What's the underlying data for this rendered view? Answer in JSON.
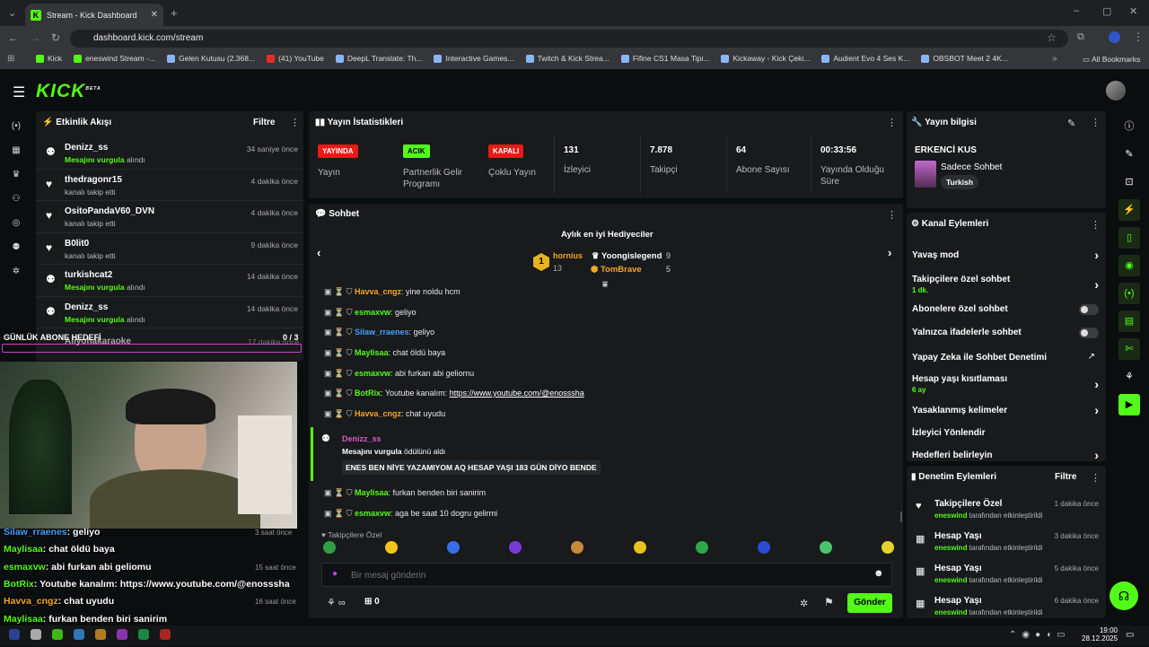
{
  "browser": {
    "tab_title": "Stream - Kick Dashboard",
    "url": "dashboard.kick.com/stream",
    "bookmarks": [
      "Kick",
      "eneswind Stream -...",
      "Gelen Kutusu (2.368...",
      "(41) YouTube",
      "DeepL Translate: Th...",
      "Interactive Games...",
      "Twitch & Kick Strea...",
      "Fifine CS1 Masa Tipi...",
      "Kickaway - Kick Çeki...",
      "Audient Evo 4 Ses K...",
      "OBSBOT Meet 2 4K..."
    ],
    "all_bookmarks": "All Bookmarks"
  },
  "brand": "KICK",
  "brand_beta": "BETA",
  "activity": {
    "title": "Etkinlik Akışı",
    "filter": "Filtre",
    "items": [
      {
        "name": "Denizz_ss",
        "green": "Mesajını vurgula",
        "rest": " alındı",
        "time": "34 saniye önce"
      },
      {
        "name": "thedragonr15",
        "green": "",
        "rest": "kanalı takip etti",
        "time": "4 dakika önce"
      },
      {
        "name": "OsitoPandaV60_DVN",
        "green": "",
        "rest": "kanalı takip etti",
        "time": "4 dakika önce"
      },
      {
        "name": "B0lit0",
        "green": "",
        "rest": "kanalı takip etti",
        "time": "9 dakika önce"
      },
      {
        "name": "turkishcat2",
        "green": "Mesajını vurgula",
        "rest": " alındı",
        "time": "14 dakika önce"
      },
      {
        "name": "Denizz_ss",
        "green": "Mesajını vurgula",
        "rest": " alındı",
        "time": "14 dakika önce"
      }
    ]
  },
  "goal": {
    "label": "GÜNLÜK ABONE HEDEFİ",
    "count": "0 / 3",
    "under_name": "Aliyohakaraoke",
    "under_time": "17 dakika önce"
  },
  "stats": {
    "title": "Yayın İstatistikleri",
    "badges": [
      {
        "badge": "YAYINDA",
        "label": "Yayın"
      },
      {
        "badge": "ACIK",
        "label": "Partnerlik Gelir Programı"
      },
      {
        "badge": "KAPALI",
        "label": "Çoklu Yayın"
      }
    ],
    "numbers": [
      {
        "value": "131",
        "label": "İzleyici"
      },
      {
        "value": "7.878",
        "label": "Takipçi"
      },
      {
        "value": "64",
        "label": "Abone Sayısı"
      },
      {
        "value": "00:33:56",
        "label": "Yayında Olduğu Süre"
      }
    ]
  },
  "chat": {
    "title": "Sohbet",
    "gifters_title": "Aylık en iyi Hediyeciler",
    "gifters": [
      {
        "rank": "1",
        "name": "hornius",
        "count": "13"
      },
      {
        "name": "Yoongislegend",
        "count": "9"
      },
      {
        "name": "TomBrave",
        "count": "5"
      }
    ],
    "messages": [
      {
        "user": "Havva_cngz",
        "text": "yine noldu hcm",
        "color": "#f5a623"
      },
      {
        "user": "esmaxvw",
        "text": "geliyo",
        "color": "#53fc18"
      },
      {
        "user": "Silaw_rraenes",
        "text": "geliyo",
        "color": "#4a9eff"
      },
      {
        "user": "Maylisaa",
        "text": "chat öldü baya",
        "color": "#53fc18"
      },
      {
        "user": "esmaxvw",
        "text": "abi furkan abi geliomu",
        "color": "#53fc18"
      },
      {
        "user": "BotRix",
        "text": "Youtube kanalım: ",
        "link": "https://www.youtube.com/@enosssha",
        "color": "#53fc18"
      },
      {
        "user": "Havva_cngz",
        "text": "chat uyudu",
        "color": "#f5a623"
      }
    ],
    "highlight": {
      "user": "Denizz_ss",
      "line1": "Mesajını vurgula",
      "line1b": " ödülünü aldı",
      "message": "ENES BEN NİYE YAZAMIYOM AQ HESAP YAŞI 183 GÜN DİYO BENDE"
    },
    "messages2": [
      {
        "user": "Maylisaa",
        "text": "furkan benden biri sanirim",
        "color": "#53fc18"
      },
      {
        "user": "esmaxvw",
        "text": "aga be saat 10 dogru gelirmi",
        "color": "#53fc18"
      }
    ],
    "followers_only": "Takipçilere Özel",
    "placeholder": "Bir mesaj gönderin",
    "send": "Gönder",
    "points": "0"
  },
  "info": {
    "title": "Yayın bilgisi",
    "stream_title": "ERKENCİ KUS",
    "category": "Sadece Sohbet",
    "tag": "Turkish"
  },
  "channel": {
    "title": "Kanal Eylemleri",
    "items": [
      {
        "label": "Yavaş mod",
        "sub": "",
        "type": "arrow"
      },
      {
        "label": "Takipçilere özel sohbet",
        "sub": "1 dk.",
        "type": "arrow"
      },
      {
        "label": "Abonelere özel sohbet",
        "sub": "",
        "type": "toggle"
      },
      {
        "label": "Yalnızca ifadelerle sohbet",
        "sub": "",
        "type": "toggle"
      },
      {
        "label": "Yapay Zeka ile Sohbet Denetimi",
        "sub": "",
        "type": "ext"
      },
      {
        "label": "Hesap yaşı kısıtlaması",
        "sub": "6 ay",
        "type": "arrow"
      },
      {
        "label": "Yasaklanmış kelimeler",
        "sub": "",
        "type": "arrow"
      },
      {
        "label": "İzleyici Yönlendir",
        "sub": "",
        "type": "none"
      },
      {
        "label": "Hedefleri belirleyin",
        "sub": "",
        "type": "arrow"
      }
    ]
  },
  "mod": {
    "title": "Denetim Eylemleri",
    "filter": "Filtre",
    "items": [
      {
        "action": "Takipçilere Özel",
        "by": "eneswind",
        "rest": " tarafından etkinleştirildi",
        "time": "1 dakika önce"
      },
      {
        "action": "Hesap Yaşı",
        "by": "eneswind",
        "rest": " tarafından etkinleştirildi",
        "time": "3 dakika önce"
      },
      {
        "action": "Hesap Yaşı",
        "by": "eneswind",
        "rest": " tarafından etkinleştirildi",
        "time": "5 dakika önce"
      },
      {
        "action": "Hesap Yaşı",
        "by": "eneswind",
        "rest": " tarafından etkinleştirildi",
        "time": "6 dakika önce"
      }
    ]
  },
  "overlay": {
    "lines": [
      {
        "user": "Silaw_rraenes",
        "text": ": geliyo",
        "color": "#4a9eff",
        "time": "3 saat önce"
      },
      {
        "user": "Maylisaa",
        "text": ": chat öldü baya",
        "color": "#53fc18",
        "time": ""
      },
      {
        "user": "esmaxvw",
        "text": ": abi furkan abi geliomu",
        "color": "#53fc18",
        "time": "15 saat önce"
      },
      {
        "user": "BotRix",
        "text": ": Youtube kanalım: https://www.youtube.com/@enosssha",
        "color": "#53fc18",
        "time": ""
      },
      {
        "user": "Havva_cngz",
        "text": ": chat uyudu",
        "color": "#f5a623",
        "time": "16 saat önce"
      },
      {
        "user": "Maylisaa",
        "text": ": furkan benden biri sanirim",
        "color": "#53fc18",
        "time": ""
      },
      {
        "user": "esmaxvw",
        "text": ": aga be saat 10 dogru gelirmi",
        "color": "#53fc18",
        "time": ""
      }
    ]
  },
  "taskbar": {
    "time": "19:00",
    "date": "28.12.2025"
  }
}
